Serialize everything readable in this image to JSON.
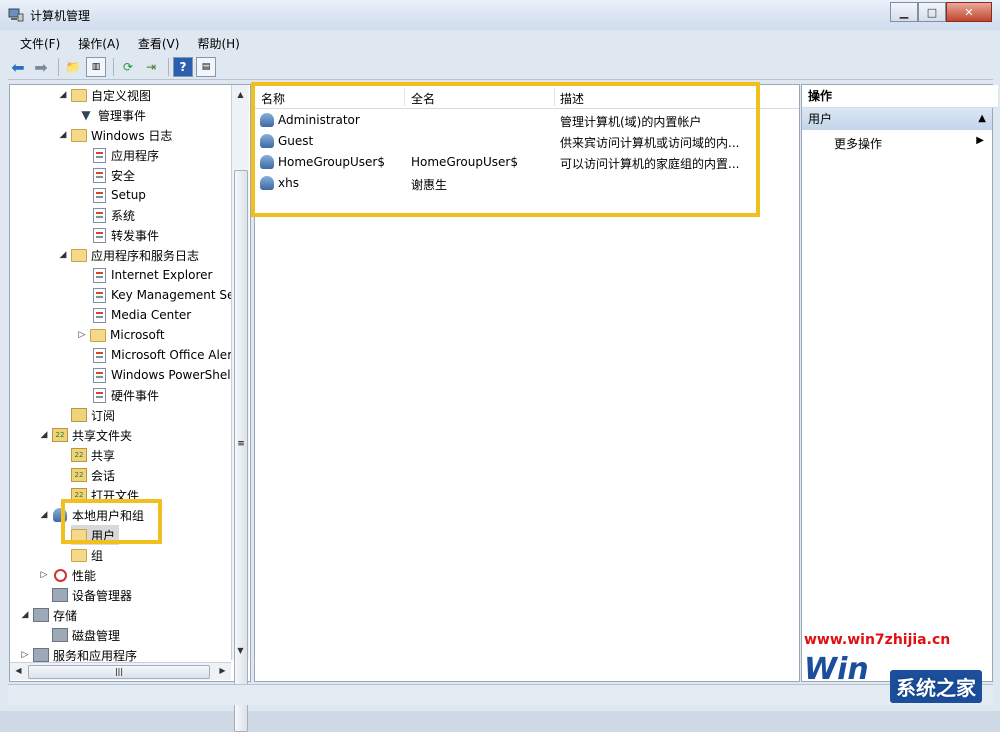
{
  "window": {
    "title": "计算机管理",
    "min": "▁",
    "max": "□",
    "close": "✕"
  },
  "menu": [
    "文件(F)",
    "操作(A)",
    "查看(V)",
    "帮助(H)"
  ],
  "tree": {
    "items": [
      {
        "label": "自定义视图",
        "exp": "◢"
      },
      {
        "label": "管理事件",
        "exp": ""
      },
      {
        "label": "Windows 日志",
        "exp": "◢"
      },
      {
        "label": "应用程序",
        "exp": ""
      },
      {
        "label": "安全",
        "exp": ""
      },
      {
        "label": "Setup",
        "exp": ""
      },
      {
        "label": "系统",
        "exp": ""
      },
      {
        "label": "转发事件",
        "exp": ""
      },
      {
        "label": "应用程序和服务日志",
        "exp": "◢"
      },
      {
        "label": "Internet Explorer",
        "exp": ""
      },
      {
        "label": "Key Management Se",
        "exp": ""
      },
      {
        "label": "Media Center",
        "exp": ""
      },
      {
        "label": "Microsoft",
        "exp": "▷"
      },
      {
        "label": "Microsoft Office Aler",
        "exp": ""
      },
      {
        "label": "Windows PowerShell",
        "exp": ""
      },
      {
        "label": "硬件事件",
        "exp": ""
      },
      {
        "label": "订阅",
        "exp": ""
      },
      {
        "label": "共享文件夹",
        "exp": "◢"
      },
      {
        "label": "共享",
        "exp": ""
      },
      {
        "label": "会话",
        "exp": ""
      },
      {
        "label": "打开文件",
        "exp": ""
      },
      {
        "label": "本地用户和组",
        "exp": "◢"
      },
      {
        "label": "用户",
        "exp": ""
      },
      {
        "label": "组",
        "exp": ""
      },
      {
        "label": "性能",
        "exp": "▷"
      },
      {
        "label": "设备管理器",
        "exp": ""
      },
      {
        "label": "存储",
        "exp": "◢"
      },
      {
        "label": "磁盘管理",
        "exp": ""
      },
      {
        "label": "服务和应用程序",
        "exp": "▷"
      }
    ]
  },
  "list": {
    "headers": [
      "名称",
      "全名",
      "描述"
    ],
    "rows": [
      {
        "name": "Administrator",
        "full": "",
        "desc": "管理计算机(域)的内置帐户"
      },
      {
        "name": "Guest",
        "full": "",
        "desc": "供来宾访问计算机或访问域的内..."
      },
      {
        "name": "HomeGroupUser$",
        "full": "HomeGroupUser$",
        "desc": "可以访问计算机的家庭组的内置..."
      },
      {
        "name": "xhs",
        "full": "谢惠生",
        "desc": ""
      }
    ]
  },
  "actions": {
    "title": "操作",
    "group": "用户",
    "group_arrow": "▲",
    "more": "更多操作",
    "more_arrow": "▶"
  },
  "watermark": {
    "url": "www.win7zhijia.cn",
    "brand": "系统之家",
    "logo": "Win"
  },
  "colors": {
    "highlight": "#f2c01e",
    "accent": "#1c4e9b"
  }
}
